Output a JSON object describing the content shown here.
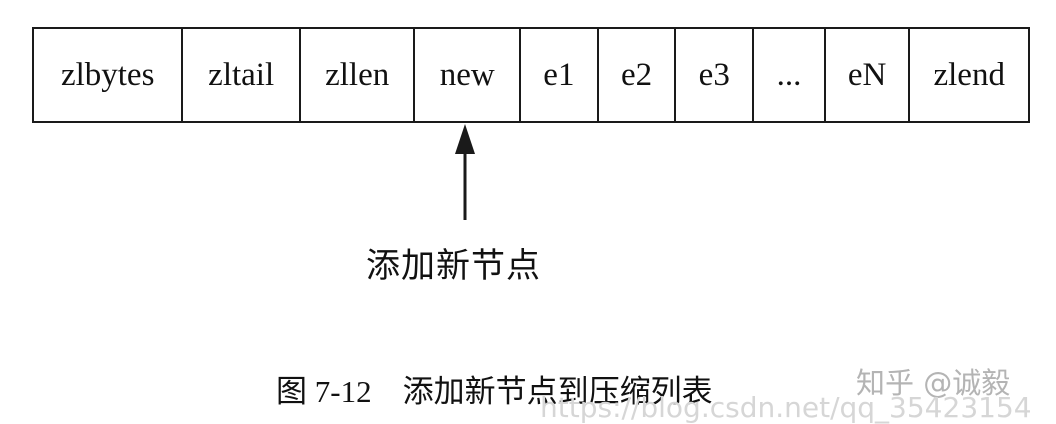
{
  "ziplist": {
    "cells": [
      {
        "label": "zlbytes"
      },
      {
        "label": "zltail"
      },
      {
        "label": "zllen"
      },
      {
        "label": "new"
      },
      {
        "label": "e1"
      },
      {
        "label": "e2"
      },
      {
        "label": "e3"
      },
      {
        "label": "..."
      },
      {
        "label": "eN"
      },
      {
        "label": "zlend"
      }
    ]
  },
  "annotation": "添加新节点",
  "caption": "图 7-12    添加新节点到压缩列表",
  "watermarks": {
    "site": "知乎 @诚毅",
    "url": "https://blog.csdn.net/qq_35423154"
  },
  "colors": {
    "line": "#1a1a1a",
    "watermark": "#b4b4b4"
  }
}
